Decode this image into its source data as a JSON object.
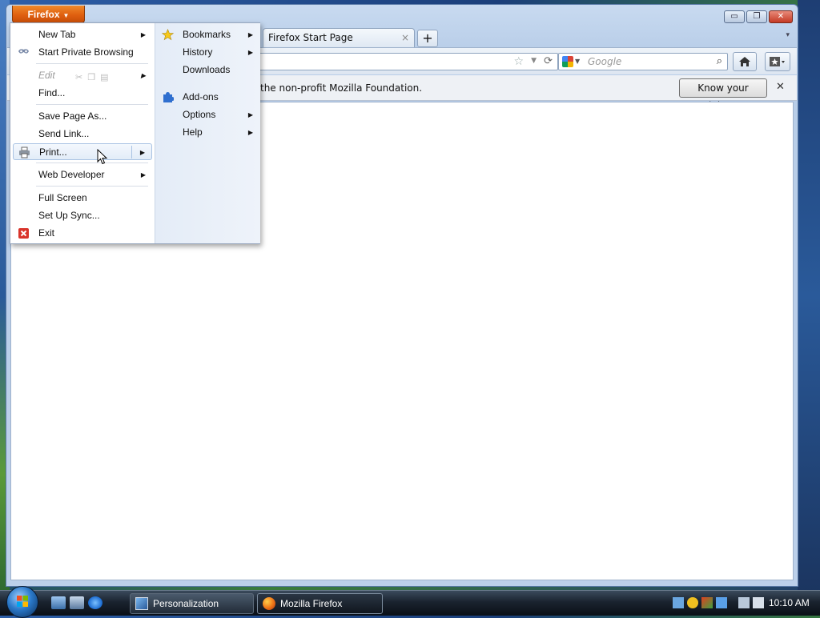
{
  "window": {
    "app_button": "Firefox",
    "caption": {
      "minimize": "▭",
      "restore": "❐",
      "close": "✕"
    }
  },
  "tab": {
    "title": "Firefox Start Page",
    "close": "×",
    "new_tab": "+",
    "list": "▾"
  },
  "search": {
    "placeholder": "Google"
  },
  "notification": {
    "text": "the non-profit Mozilla Foundation.",
    "button": "Know your rights...",
    "close": "✕"
  },
  "menu": {
    "left": [
      {
        "label": "New Tab",
        "submenu": true
      },
      {
        "label": "Start Private Browsing",
        "icon": "private-browsing-icon"
      },
      {
        "label": "Edit",
        "submenu": true,
        "disabled": true
      },
      {
        "label": "Find..."
      },
      {
        "label": "Save Page As..."
      },
      {
        "label": "Send Link..."
      },
      {
        "label": "Print...",
        "submenu": true,
        "icon": "printer-icon",
        "hover": true
      },
      {
        "label": "Web Developer",
        "submenu": true
      },
      {
        "label": "Full Screen"
      },
      {
        "label": "Set Up Sync..."
      },
      {
        "label": "Exit",
        "icon": "exit-icon"
      }
    ],
    "right": [
      {
        "label": "Bookmarks",
        "submenu": true,
        "icon": "star-icon"
      },
      {
        "label": "History",
        "submenu": true
      },
      {
        "label": "Downloads"
      },
      {
        "label": "Add-ons",
        "icon": "puzzle-icon"
      },
      {
        "label": "Options",
        "submenu": true
      },
      {
        "label": "Help",
        "submenu": true
      }
    ],
    "arrow": "▶"
  },
  "taskbar": {
    "tasks": [
      {
        "label": "Personalization",
        "icon": "personalization-icon"
      },
      {
        "label": "Mozilla Firefox",
        "icon": "firefox-icon",
        "active": true
      }
    ],
    "clock": "10:10 AM"
  },
  "colors": {
    "firefox_orange": "#e06010",
    "menu_hover_border": "#a9c3e3",
    "taskbar": "#1a232f"
  }
}
